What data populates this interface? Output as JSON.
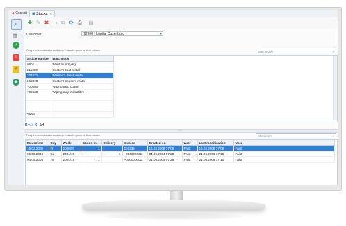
{
  "tabs": [
    {
      "label": "Cockpit",
      "icon": "cockpit-icon"
    },
    {
      "label": "Stocks",
      "icon": "stocks-icon",
      "close": "×"
    }
  ],
  "toolbar_icons": [
    "add-icon",
    "edit-icon",
    "delete-icon",
    "save-icon",
    "copy-icon",
    "refresh-icon",
    "print-icon",
    "export-icon"
  ],
  "customer": {
    "label": "Customer",
    "value": "72300 Hospital Cuxenburg"
  },
  "group_hint": "Drag a column header and drop it here to group by that column",
  "articles": {
    "search_placeholder": "Matchcode",
    "columns": [
      "Article number",
      "Matchcode"
    ],
    "rows": [
      [
        "0801",
        "Ward laundry kg"
      ],
      [
        "211000",
        "Doctor's coat rental"
      ],
      [
        "221021",
        "Women's dress rental"
      ],
      [
        "262020",
        "Doctor's trousers rental"
      ],
      [
        "700000",
        "Wiping mop cotton"
      ],
      [
        "700100",
        "Wiping mop microfibre"
      ]
    ],
    "selected_index": 2,
    "total_label": "Total:",
    "pager": {
      "first": "K",
      "prev": "<",
      "next": ">",
      "last": "K",
      "position": "3/4"
    }
  },
  "movements": {
    "search_placeholder": "Movement",
    "columns": [
      "Movement",
      "Day",
      "Week",
      "Goods-in",
      "Delivery",
      "Invoice",
      "Created on",
      "User",
      "Last modification",
      "User"
    ],
    "rows": [
      [
        "15.02.2008",
        "Fr",
        "2008/07",
        "1",
        "",
        "201335",
        "15.02.2008 17:08",
        "Faist",
        "15.02.2008 17:08",
        "Faist"
      ],
      [
        "08.05.2004",
        "Sa",
        "2004/19",
        "",
        "1",
        "~000000001",
        "04.06.2004 07:28",
        "Faist",
        "21.06.2006 17:10",
        "Faist"
      ],
      [
        "04.05.2004",
        "Tu",
        "2004/19",
        "1",
        "",
        "~000000001",
        "04.06.2004 07:26",
        "Faist",
        "21.06.2006 17:10",
        "Faist"
      ]
    ],
    "selected_index": 0
  },
  "colors": {
    "accent": "#2f7fd8",
    "header": "#eef2f7"
  }
}
